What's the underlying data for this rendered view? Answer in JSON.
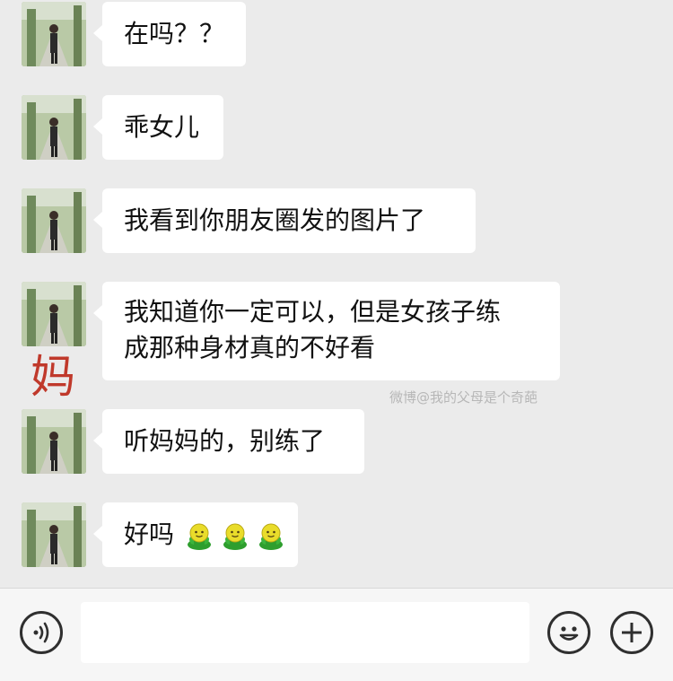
{
  "chat": {
    "sender_tag": "妈",
    "watermark": "微博@我的父母是个奇葩",
    "messages": [
      {
        "lines": [
          "在吗？？"
        ]
      },
      {
        "lines": [
          "乖女儿"
        ]
      },
      {
        "lines": [
          "我看到你朋友圈发的图片了"
        ]
      },
      {
        "lines": [
          "我知道你一定可以，但是女孩子练",
          "成那种身材真的不好看"
        ]
      },
      {
        "lines": [
          "听妈妈的，别练了"
        ]
      },
      {
        "lines": [
          "好吗"
        ],
        "emojis": [
          "sprout-face-emoji",
          "sprout-face-emoji",
          "sprout-face-emoji"
        ]
      }
    ]
  },
  "input_bar": {
    "voice_icon": "voice-icon",
    "emoji_icon": "smiley-icon",
    "plus_icon": "plus-icon",
    "text_value": ""
  },
  "colors": {
    "background": "#ebebeb",
    "bubble": "#ffffff",
    "sender_tag": "#c0392b",
    "input_bar": "#f6f6f6"
  }
}
